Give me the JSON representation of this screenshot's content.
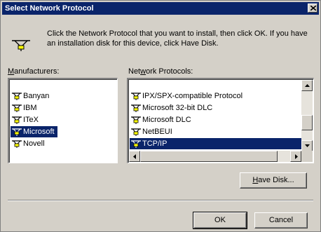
{
  "window": {
    "title": "Select Network Protocol",
    "colors": {
      "titlebar": "#0a246a",
      "face": "#d4d0c8",
      "selection": "#0a246a"
    }
  },
  "intro": {
    "icon": "network-protocol-icon",
    "text": "Click the Network Protocol that you want to install, then click OK. If you have an installation disk for this device, click Have Disk."
  },
  "manufacturers": {
    "label_mnemonic": "M",
    "label_rest": "anufacturers:",
    "items": [
      {
        "label": "Banyan",
        "selected": false
      },
      {
        "label": "IBM",
        "selected": false
      },
      {
        "label": "ITeX",
        "selected": false
      },
      {
        "label": "Microsoft",
        "selected": true
      },
      {
        "label": "Novell",
        "selected": false
      }
    ]
  },
  "protocols": {
    "label_pre": "Net",
    "label_mnemonic": "w",
    "label_post": "ork Protocols:",
    "items": [
      {
        "label": "IPX/SPX-compatible Protocol",
        "selected": false
      },
      {
        "label": "Microsoft 32-bit DLC",
        "selected": false
      },
      {
        "label": "Microsoft DLC",
        "selected": false
      },
      {
        "label": "NetBEUI",
        "selected": false
      },
      {
        "label": "TCP/IP",
        "selected": true
      }
    ]
  },
  "buttons": {
    "have_disk_mnemonic": "H",
    "have_disk_rest": "ave Disk...",
    "ok": "OK",
    "cancel": "Cancel"
  }
}
